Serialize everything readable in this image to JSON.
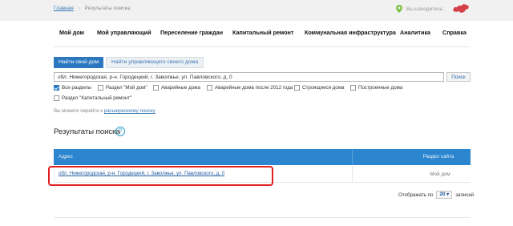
{
  "breadcrumb": {
    "home": "Главная",
    "current": "Результаты поиска"
  },
  "location": {
    "text": "Вы находитесь:",
    "icon": "map-pin-icon",
    "map_icon": "russia-map-icon"
  },
  "nav": {
    "items": [
      "Мой дом",
      "Мой управляющий",
      "Переселение граждан",
      "Капитальный ремонт",
      "Коммунальная инфраструктура",
      "Аналитика",
      "Справка"
    ]
  },
  "tabs": {
    "active": "Найти свой дом",
    "inactive": "Найти управляющего своего дома"
  },
  "search": {
    "value": "обл. Нижегородская, р-н. Городецкий, г. Заволжье, ул. Павловского, д. 0",
    "button": "Поиск"
  },
  "filters": [
    {
      "label": "Все разделы",
      "checked": true
    },
    {
      "label": "Раздел \"Мой дом\"",
      "checked": false
    },
    {
      "label": "Аварийные дома",
      "checked": false
    },
    {
      "label": "Аварийные дома после 2012 года",
      "checked": false
    },
    {
      "label": "Строящиеся дома",
      "checked": false
    },
    {
      "label": "Построенные дома",
      "checked": false
    },
    {
      "label": "Раздел \"Капитальный ремонт\"",
      "checked": false
    }
  ],
  "hint": {
    "prefix": "Вы можете перейти к ",
    "link": "расширенному поиску"
  },
  "results": {
    "title": "Результаты поиска",
    "help": "?",
    "columns": [
      "Адрес",
      "Раздел сайта"
    ],
    "rows": [
      {
        "address": "обл. Нижегородская, р-н. Городецкий, г. Заволжье, ул. Павловского, д. 0",
        "section": "Мой дом"
      }
    ]
  },
  "pager": {
    "prefix": "Отображать по",
    "value": "20",
    "suffix": "записей"
  },
  "colors": {
    "accent": "#2b78c0",
    "table_header": "#2b85cf",
    "highlight": "#e01f1f"
  }
}
